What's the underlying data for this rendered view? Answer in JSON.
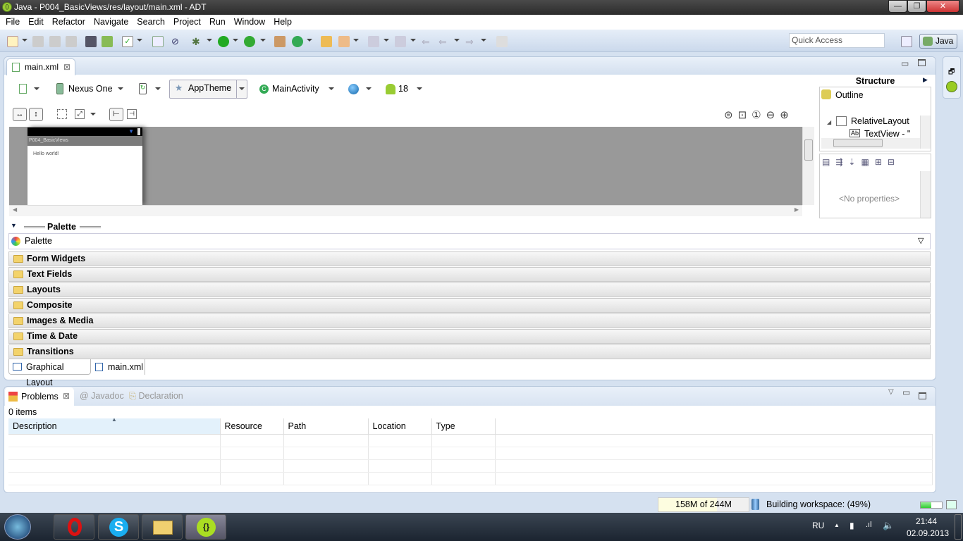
{
  "window": {
    "title": "Java - P004_BasicViews/res/layout/main.xml - ADT",
    "min": "—",
    "max": "❐",
    "close": "✕"
  },
  "menu": [
    "File",
    "Edit",
    "Refactor",
    "Navigate",
    "Search",
    "Project",
    "Run",
    "Window",
    "Help"
  ],
  "toolbar": {
    "quick_access_placeholder": "Quick Access",
    "perspective": "Java"
  },
  "editor": {
    "tab": "main.xml",
    "config": {
      "device": "Nexus One",
      "theme": "AppTheme",
      "activity": "MainActivity",
      "api": "18"
    },
    "preview": {
      "app_title": "P004_BasicViews",
      "text": "Hello world!"
    },
    "structure": {
      "title": "Structure",
      "outline": "Outline",
      "tree": [
        "RelativeLayout",
        "TextView - \"He"
      ],
      "no_properties": "<No properties>"
    },
    "palette": {
      "header": "Palette",
      "label": "Palette",
      "categories": [
        "Form Widgets",
        "Text Fields",
        "Layouts",
        "Composite",
        "Images & Media",
        "Time & Date",
        "Transitions"
      ]
    },
    "bottom_tabs": [
      "Graphical Layout",
      "main.xml"
    ]
  },
  "problems": {
    "tabs": [
      "Problems",
      "Javadoc",
      "Declaration"
    ],
    "count": "0 items",
    "columns": [
      "Description",
      "Resource",
      "Path",
      "Location",
      "Type"
    ]
  },
  "status": {
    "heap": "158M of 244M",
    "heap_used_fraction": 0.65,
    "build": "Building workspace: (49%)",
    "build_progress": 0.49
  },
  "taskbar": {
    "lang": "RU",
    "time": "21:44",
    "date": "02.09.2013"
  },
  "colors": {
    "accent": "#d5e1f0",
    "canvas": "#999999",
    "progress": "#3ccf3c"
  }
}
